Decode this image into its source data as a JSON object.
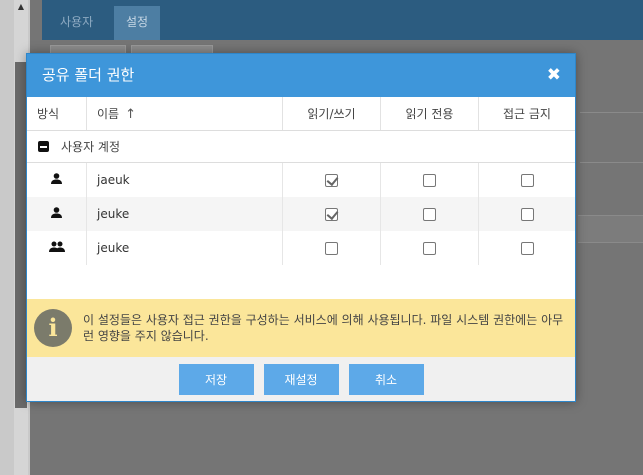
{
  "background": {
    "tabs": [
      {
        "label": "사용자"
      },
      {
        "label": "설정"
      }
    ]
  },
  "dialog": {
    "title": "공유 폴더 권한",
    "close_glyph": "✖",
    "columns": {
      "type": "방식",
      "name": "이름",
      "sort_glyph": "↑",
      "read_write": "읽기/쓰기",
      "read_only": "읽기 전용",
      "deny": "접근 금지"
    },
    "group": {
      "label": "사용자 계정"
    },
    "rows": [
      {
        "icon": "user-icon",
        "name": "jaeuk",
        "read_write": true,
        "read_only": false,
        "deny": false
      },
      {
        "icon": "user-icon",
        "name": "jeuke",
        "read_write": true,
        "read_only": false,
        "deny": false
      },
      {
        "icon": "group-icon",
        "name": "jeuke",
        "read_write": false,
        "read_only": false,
        "deny": false
      }
    ],
    "notice": {
      "icon": "info-icon",
      "glyph": "i",
      "text": "이 설정들은 사용자 접근 권한을 구성하는 서비스에 의해 사용됩니다. 파일 시스템 권한에는 아무런 영향을 주지 않습니다."
    },
    "buttons": {
      "save": "저장",
      "reset": "재설정",
      "cancel": "취소"
    }
  },
  "colors": {
    "title_bar": "#3e96da",
    "button": "#5da9e8",
    "notice_bg": "#fbe69a"
  }
}
